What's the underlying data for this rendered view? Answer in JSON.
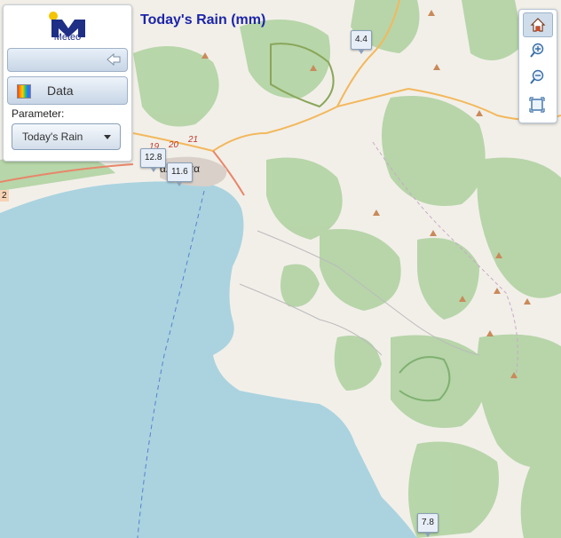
{
  "panel": {
    "logo_text": "Meteo",
    "data_button": "Data",
    "parameter_label": "Parameter:",
    "parameter_value": "Today's Rain"
  },
  "map": {
    "title": "Today's Rain (mm)",
    "city_label": "αλαμάτα",
    "road_numbers": [
      "19",
      "20",
      "21"
    ],
    "edge_label": "2"
  },
  "stations": [
    {
      "value": "4.4"
    },
    {
      "value": "12.8"
    },
    {
      "value": "11.6"
    },
    {
      "value": "7.8"
    }
  ],
  "toolbar": {
    "icons": [
      "home-icon",
      "zoom-in-icon",
      "zoom-out-icon",
      "extent-icon"
    ]
  },
  "colors": {
    "sea": "#aad3df",
    "land": "#f2efe9",
    "forest": "#add19e",
    "accent": "#1c25a8",
    "logo_blue": "#1f2f86",
    "logo_yellow": "#f4c400"
  }
}
